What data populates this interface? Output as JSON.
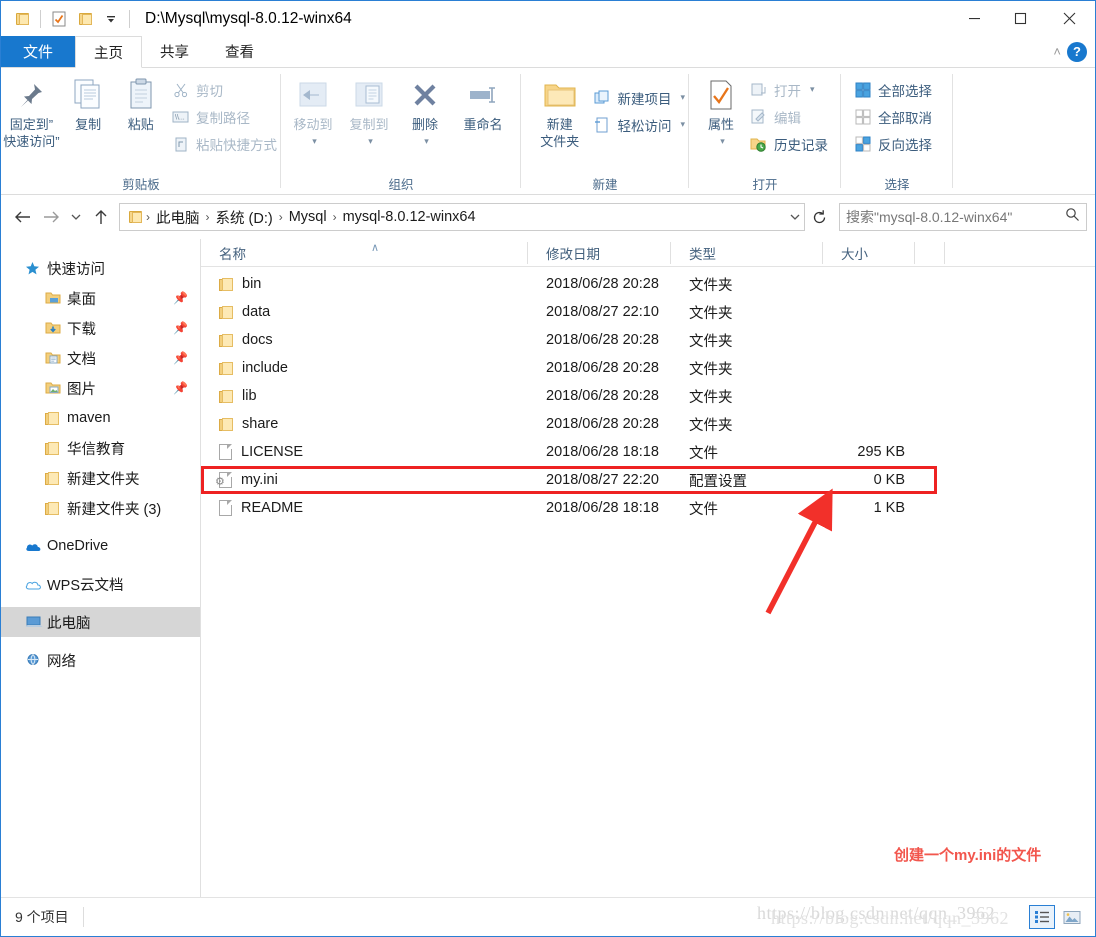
{
  "window": {
    "title": "D:\\Mysql\\mysql-8.0.12-winx64",
    "qat_icons": [
      "folder-icon",
      "properties-icon",
      "new-folder-icon",
      "customize-dropdown-icon"
    ],
    "minimize_label": "─",
    "maximize_label": "□",
    "close_label": "✕",
    "collapse_ribbon_label": "˄",
    "help_label": "?"
  },
  "tabs": [
    {
      "label": "文件",
      "type": "file"
    },
    {
      "label": "主页",
      "type": "active"
    },
    {
      "label": "共享",
      "type": "normal"
    },
    {
      "label": "查看",
      "type": "normal"
    }
  ],
  "ribbon": {
    "groups": [
      {
        "name": "clipboard",
        "label": "剪贴板",
        "big": [
          {
            "label": "固定到”\n快速访问”",
            "line1": "固定到”",
            "line2": "快速访问”",
            "icon": "pin-icon"
          },
          {
            "label": "复制",
            "line1": "复制",
            "line2": "",
            "icon": "copy-icon"
          },
          {
            "label": "粘贴",
            "line1": "粘贴",
            "line2": "",
            "icon": "paste-icon"
          }
        ],
        "small": [
          {
            "label": "剪切",
            "icon": "scissors-icon",
            "dim": true
          },
          {
            "label": "复制路径",
            "icon": "copy-path-icon",
            "dim": true
          },
          {
            "label": "粘贴快捷方式",
            "icon": "paste-shortcut-icon",
            "dim": true
          }
        ]
      },
      {
        "name": "organize",
        "label": "组织",
        "big": [
          {
            "line1": "移动到",
            "line2": "",
            "icon": "move-to-icon",
            "dim": true,
            "caret": true
          },
          {
            "line1": "复制到",
            "line2": "",
            "icon": "copy-to-icon",
            "dim": true,
            "caret": true
          },
          {
            "line1": "删除",
            "line2": "",
            "icon": "delete-icon",
            "caret": true
          },
          {
            "line1": "重命名",
            "line2": "",
            "icon": "rename-icon"
          }
        ],
        "small": []
      },
      {
        "name": "new",
        "label": "新建",
        "big": [
          {
            "line1": "新建",
            "line2": "文件夹",
            "icon": "new-folder-icon"
          }
        ],
        "small": [
          {
            "label": "新建项目",
            "icon": "new-item-icon",
            "caret": true
          },
          {
            "label": "轻松访问",
            "icon": "easy-access-icon",
            "caret": true
          }
        ]
      },
      {
        "name": "open",
        "label": "打开",
        "big": [
          {
            "line1": "属性",
            "line2": "",
            "icon": "properties-icon",
            "caret": true
          }
        ],
        "small": [
          {
            "label": "打开",
            "icon": "open-icon",
            "dim": true,
            "caret": true
          },
          {
            "label": "编辑",
            "icon": "edit-icon",
            "dim": true
          },
          {
            "label": "历史记录",
            "icon": "history-icon"
          }
        ]
      },
      {
        "name": "select",
        "label": "选择",
        "big": [],
        "small": [
          {
            "label": "全部选择",
            "icon": "select-all-icon"
          },
          {
            "label": "全部取消",
            "icon": "select-none-icon"
          },
          {
            "label": "反向选择",
            "icon": "invert-selection-icon"
          }
        ]
      }
    ]
  },
  "address": {
    "back_icon": "back-arrow-icon",
    "forward_icon": "forward-arrow-icon",
    "recent_icon": "chevron-down-icon",
    "up_icon": "up-arrow-icon",
    "breadcrumbs": [
      "此电脑",
      "系统 (D:)",
      "Mysql",
      "mysql-8.0.12-winx64"
    ],
    "separator": "›",
    "dropdown_icon": "chevron-down-icon",
    "refresh_icon": "refresh-icon",
    "search_placeholder": "搜索\"mysql-8.0.12-winx64\"",
    "search_icon": "search-icon"
  },
  "navpane": {
    "items": [
      {
        "label": "快速访问",
        "icon": "star-icon",
        "indent": false,
        "pinned": false,
        "selected": false
      },
      {
        "label": "桌面",
        "icon": "desktop-folder-icon",
        "indent": true,
        "pinned": true,
        "selected": false
      },
      {
        "label": "下载",
        "icon": "downloads-folder-icon",
        "indent": true,
        "pinned": true,
        "selected": false
      },
      {
        "label": "文档",
        "icon": "documents-folder-icon",
        "indent": true,
        "pinned": true,
        "selected": false
      },
      {
        "label": "图片",
        "icon": "pictures-folder-icon",
        "indent": true,
        "pinned": true,
        "selected": false
      },
      {
        "label": "maven",
        "icon": "folder-icon",
        "indent": true,
        "pinned": false,
        "selected": false
      },
      {
        "label": "华信教育",
        "icon": "folder-icon",
        "indent": true,
        "pinned": false,
        "selected": false
      },
      {
        "label": "新建文件夹",
        "icon": "folder-icon",
        "indent": true,
        "pinned": false,
        "selected": false
      },
      {
        "label": "新建文件夹 (3)",
        "icon": "folder-icon",
        "indent": true,
        "pinned": false,
        "selected": false
      },
      {
        "label": "OneDrive",
        "icon": "onedrive-icon",
        "indent": false,
        "pinned": false,
        "selected": false
      },
      {
        "label": "WPS云文档",
        "icon": "wps-cloud-icon",
        "indent": false,
        "pinned": false,
        "selected": false
      },
      {
        "label": "此电脑",
        "icon": "this-pc-icon",
        "indent": false,
        "pinned": false,
        "selected": true
      },
      {
        "label": "网络",
        "icon": "network-icon",
        "indent": false,
        "pinned": false,
        "selected": false
      }
    ]
  },
  "filelist": {
    "columns": [
      "名称",
      "修改日期",
      "类型",
      "大小"
    ],
    "sort_indicator": "∧",
    "rows": [
      {
        "name": "bin",
        "date": "2018/06/28 20:28",
        "type": "文件夹",
        "size": "",
        "icon": "folder-icon",
        "highlighted": false
      },
      {
        "name": "data",
        "date": "2018/08/27 22:10",
        "type": "文件夹",
        "size": "",
        "icon": "folder-icon",
        "highlighted": false
      },
      {
        "name": "docs",
        "date": "2018/06/28 20:28",
        "type": "文件夹",
        "size": "",
        "icon": "folder-icon",
        "highlighted": false
      },
      {
        "name": "include",
        "date": "2018/06/28 20:28",
        "type": "文件夹",
        "size": "",
        "icon": "folder-icon",
        "highlighted": false
      },
      {
        "name": "lib",
        "date": "2018/06/28 20:28",
        "type": "文件夹",
        "size": "",
        "icon": "folder-icon",
        "highlighted": false
      },
      {
        "name": "share",
        "date": "2018/06/28 20:28",
        "type": "文件夹",
        "size": "",
        "icon": "folder-icon",
        "highlighted": false
      },
      {
        "name": "LICENSE",
        "date": "2018/06/28 18:18",
        "type": "文件",
        "size": "295 KB",
        "icon": "file-icon",
        "highlighted": false
      },
      {
        "name": "my.ini",
        "date": "2018/08/27 22:20",
        "type": "配置设置",
        "size": "0 KB",
        "icon": "config-file-icon",
        "highlighted": true
      },
      {
        "name": "README",
        "date": "2018/06/28 18:18",
        "type": "文件",
        "size": "1 KB",
        "icon": "file-icon",
        "highlighted": false
      }
    ]
  },
  "annotation": {
    "text": "创建一个my.ini的文件",
    "color": "#f2564d",
    "highlight_color": "#ee2222"
  },
  "statusbar": {
    "item_count": "9 个项目",
    "view_details_icon": "details-view-icon",
    "view_thumbnails_icon": "thumbnails-view-icon"
  },
  "watermark": {
    "text": "https://blog.csdn.net/qqn_3962"
  }
}
